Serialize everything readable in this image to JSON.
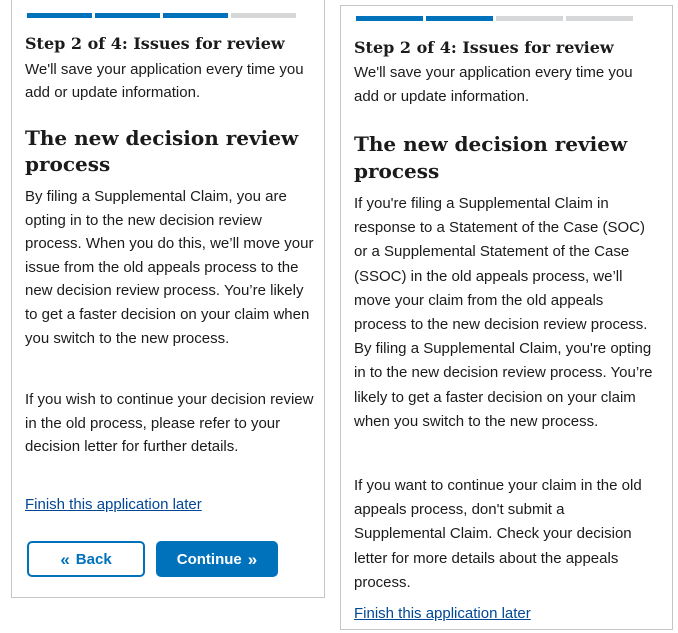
{
  "colors": {
    "primary": "#0071bb",
    "link": "#004795",
    "segment_inactive": "#d6d7d9",
    "text": "#1b1b1b"
  },
  "left_panel": {
    "progress": {
      "completed_segments": 3,
      "total_segments": 4
    },
    "step_title": "Step 2 of 4: Issues for review",
    "save_note": "We'll save your application every time you add or update information.",
    "heading": "The new decision review process",
    "paragraph1": "By filing a Supplemental Claim, you are opting in to the new decision review process. When you do this, we’ll move your issue from the old appeals process to the new decision review process. You’re likely to get a faster decision on your claim when you switch to the new process.",
    "paragraph2": "If you wish to continue your decision review in the old process, please refer to your decision letter for further details.",
    "finish_later_link": "Finish this application later",
    "back_button": {
      "label": "Back",
      "icon": "double-chevron-left-icon",
      "glyph": "«"
    },
    "continue_button": {
      "label": "Continue",
      "icon": "double-chevron-right-icon",
      "glyph": "»"
    }
  },
  "right_panel": {
    "progress": {
      "completed_segments": 2,
      "total_segments": 4
    },
    "step_title": "Step 2 of 4: Issues for review",
    "save_note": "We'll save your application every time you add or update information.",
    "heading": "The new decision review process",
    "paragraph1": "If you're filing a Supplemental Claim in response to a Statement of the Case (SOC) or a Supplemental Statement of the Case (SSOC) in the old appeals process, we’ll move your claim from the old appeals process to the new decision review process. By filing a Supplemental Claim, you're opting in to the new decision review process. You’re likely to get a faster decision on your claim when you switch to the new process.",
    "paragraph2": "If you want to continue your claim in the old appeals process, don't submit a Supplemental Claim. Check your decision letter for more details about the appeals process.",
    "finish_later_link": "Finish this application later"
  }
}
